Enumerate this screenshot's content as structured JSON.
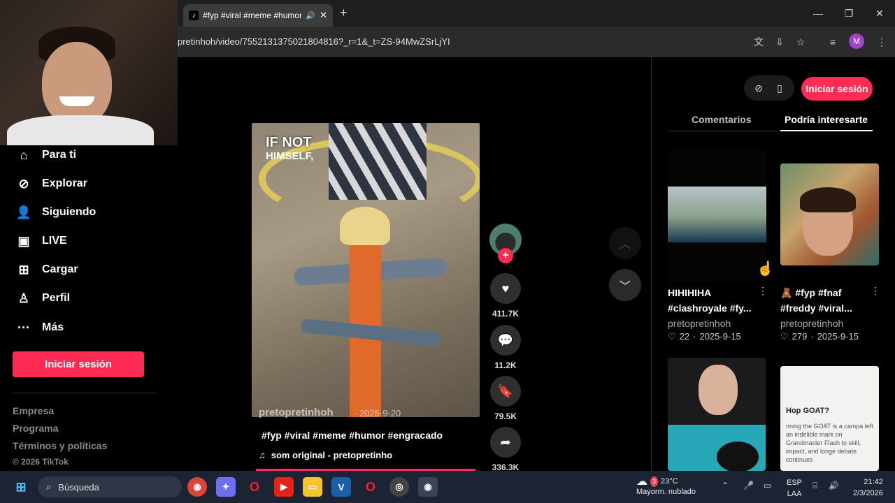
{
  "browser": {
    "tab_title": "#fyp #viral #meme #humor",
    "tab_favicon": "tiktok-icon",
    "url": "pretinhoh/video/7552131375021804816?_r=1&_t=ZS-94MwZSrLjYI",
    "profile_letter": "M",
    "profile_color": "#a142c9"
  },
  "sidebar": {
    "items": [
      {
        "label": "Para ti",
        "icon": "home-icon"
      },
      {
        "label": "Explorar",
        "icon": "compass-icon"
      },
      {
        "label": "Siguiendo",
        "icon": "following-icon"
      },
      {
        "label": "LIVE",
        "icon": "live-icon"
      },
      {
        "label": "Cargar",
        "icon": "upload-icon"
      },
      {
        "label": "Perfil",
        "icon": "profile-icon"
      },
      {
        "label": "Más",
        "icon": "more-icon"
      }
    ],
    "login_label": "Iniciar sesión",
    "footer": [
      "Empresa",
      "Programa",
      "Términos y políticas"
    ],
    "copyright": "© 2026 TikTok"
  },
  "video": {
    "overlay_line1": "IF NOT",
    "overlay_line2": "HIMSELF,",
    "watermark": "pretopretinhoh",
    "watermark_date": "· 2025-9-20",
    "caption": "#fyp #viral #meme #humor #engracado",
    "music": "som original - pretopretinho"
  },
  "actions": {
    "likes": "411.7K",
    "comments": "11.2K",
    "saves": "79.5K",
    "shares": "336.3K"
  },
  "right_panel": {
    "login_label": "Iniciar sesión",
    "tabs": [
      "Comentarios",
      "Podría interesarte"
    ],
    "cards": [
      {
        "title_line1": "HIHIHIHA",
        "title_line2": "#clashroyale #fy...",
        "author": "pretopretinhoh",
        "likes": "22",
        "date": "2025-9-15"
      },
      {
        "title_line1": "🧸 #fyp #fnaf",
        "title_line2": "#freddy #viral...",
        "author": "pretopretinhoh",
        "likes": "279",
        "date": "2025-9-15"
      }
    ],
    "goat_text": "Hop GOAT?",
    "goat_body": "nning the GOAT is a campa left an indelible mark on Grandmaster Flash to skill, impact, and longe debate continues"
  },
  "taskbar": {
    "search_placeholder": "Búsqueda",
    "weather_temp": "23°C",
    "weather_desc": "Mayorm. nublado",
    "weather_badge": "3",
    "lang_line1": "ESP",
    "lang_line2": "LAA",
    "time": "21:42",
    "date": "2/3/2026"
  },
  "colors": {
    "accent": "#fe2c55",
    "background": "#000000",
    "taskbar": "#1c2433"
  }
}
